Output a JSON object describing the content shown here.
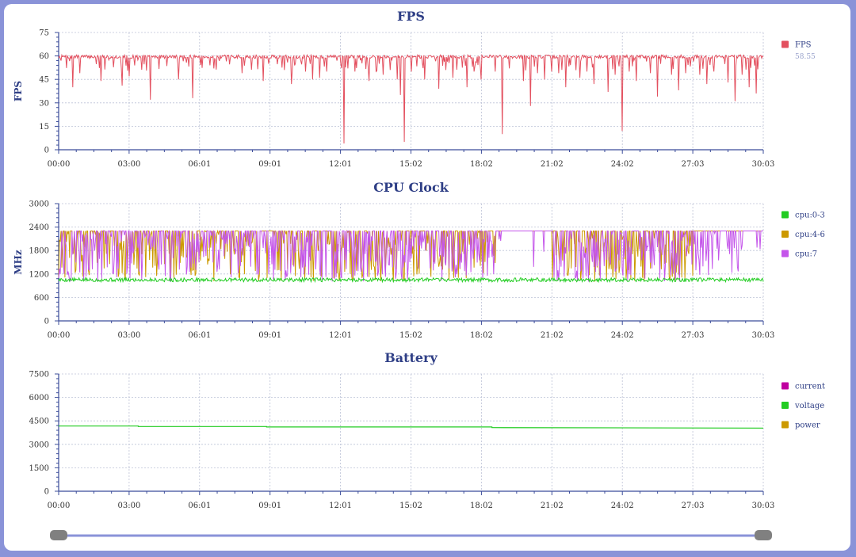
{
  "colors": {
    "frame": "#8a93d8",
    "fps": "#e3505f",
    "cpu03": "#22cc22",
    "cpu46": "#cc9900",
    "cpu7": "#c455ea",
    "current": "#c000a0",
    "voltage": "#22cc22",
    "power": "#cc9900",
    "slider_track": "#8a93d8",
    "slider_handle": "#808080"
  },
  "x_ticks": [
    "00:00",
    "03:00",
    "06:01",
    "09:01",
    "12:01",
    "15:02",
    "18:02",
    "21:02",
    "24:02",
    "27:03",
    "30:03"
  ],
  "slider": {
    "start": 0,
    "end": 1
  },
  "chart_data": [
    {
      "type": "line",
      "title": "FPS",
      "ylabel": "FPS",
      "ylim": [
        0,
        75
      ],
      "y_ticks": [
        0,
        15,
        30,
        45,
        60,
        75
      ],
      "grid": true,
      "legend": "right",
      "series": [
        {
          "name": "FPS",
          "value_label": "58.55",
          "baseline": 59.5,
          "dips": [
            [
              0.02,
              40
            ],
            [
              0.03,
              49
            ],
            [
              0.06,
              44
            ],
            [
              0.09,
              41
            ],
            [
              0.1,
              47
            ],
            [
              0.13,
              50
            ],
            [
              0.13,
              32
            ],
            [
              0.17,
              45
            ],
            [
              0.19,
              33
            ],
            [
              0.22,
              52
            ],
            [
              0.26,
              49
            ],
            [
              0.29,
              44
            ],
            [
              0.32,
              51
            ],
            [
              0.33,
              42
            ],
            [
              0.35,
              50
            ],
            [
              0.36,
              45
            ],
            [
              0.37,
              46
            ],
            [
              0.38,
              50
            ],
            [
              0.4,
              55
            ],
            [
              0.405,
              4
            ],
            [
              0.41,
              52
            ],
            [
              0.42,
              50
            ],
            [
              0.44,
              44
            ],
            [
              0.45,
              50
            ],
            [
              0.46,
              48
            ],
            [
              0.47,
              51
            ],
            [
              0.48,
              45
            ],
            [
              0.485,
              35
            ],
            [
              0.49,
              5
            ],
            [
              0.5,
              50
            ],
            [
              0.52,
              45
            ],
            [
              0.54,
              39
            ],
            [
              0.55,
              51
            ],
            [
              0.56,
              46
            ],
            [
              0.58,
              40
            ],
            [
              0.59,
              50
            ],
            [
              0.6,
              45
            ],
            [
              0.62,
              50
            ],
            [
              0.63,
              10
            ],
            [
              0.64,
              52
            ],
            [
              0.66,
              44
            ],
            [
              0.67,
              28
            ],
            [
              0.68,
              49
            ],
            [
              0.69,
              45
            ],
            [
              0.7,
              50
            ],
            [
              0.71,
              49
            ],
            [
              0.72,
              40
            ],
            [
              0.74,
              46
            ],
            [
              0.75,
              50
            ],
            [
              0.76,
              42
            ],
            [
              0.78,
              37
            ],
            [
              0.79,
              48
            ],
            [
              0.8,
              12
            ],
            [
              0.81,
              50
            ],
            [
              0.82,
              44
            ],
            [
              0.84,
              49
            ],
            [
              0.85,
              34
            ],
            [
              0.87,
              48
            ],
            [
              0.88,
              38
            ],
            [
              0.89,
              49
            ],
            [
              0.91,
              48
            ],
            [
              0.92,
              42
            ],
            [
              0.93,
              50
            ],
            [
              0.95,
              43
            ],
            [
              0.96,
              31
            ],
            [
              0.97,
              48
            ],
            [
              0.98,
              40
            ],
            [
              0.99,
              36
            ]
          ]
        }
      ]
    },
    {
      "type": "line",
      "title": "CPU Clock",
      "ylabel": "MHz",
      "ylim": [
        0,
        3000
      ],
      "y_ticks": [
        0,
        600,
        1200,
        1800,
        2400,
        3000
      ],
      "grid": true,
      "legend": "right",
      "series": [
        {
          "name": "cpu:0-3",
          "low": 1000,
          "high": 1100
        },
        {
          "name": "cpu:4-6",
          "low": 1000,
          "high": 2300
        },
        {
          "name": "cpu:7",
          "low": 1000,
          "high": 2300
        }
      ]
    },
    {
      "type": "line",
      "title": "Battery",
      "ylabel": "",
      "ylim": [
        0,
        7500
      ],
      "y_ticks": [
        0,
        1500,
        3000,
        4500,
        6000,
        7500
      ],
      "grid": true,
      "legend": "right",
      "series": [
        {
          "name": "current",
          "points": []
        },
        {
          "name": "voltage",
          "points": [
            [
              0,
              4170
            ],
            [
              0.113,
              4170
            ],
            [
              0.113,
              4140
            ],
            [
              0.295,
              4140
            ],
            [
              0.295,
              4110
            ],
            [
              0.615,
              4110
            ],
            [
              0.615,
              4070
            ],
            [
              1,
              4040
            ]
          ]
        },
        {
          "name": "power",
          "points": []
        }
      ]
    }
  ]
}
